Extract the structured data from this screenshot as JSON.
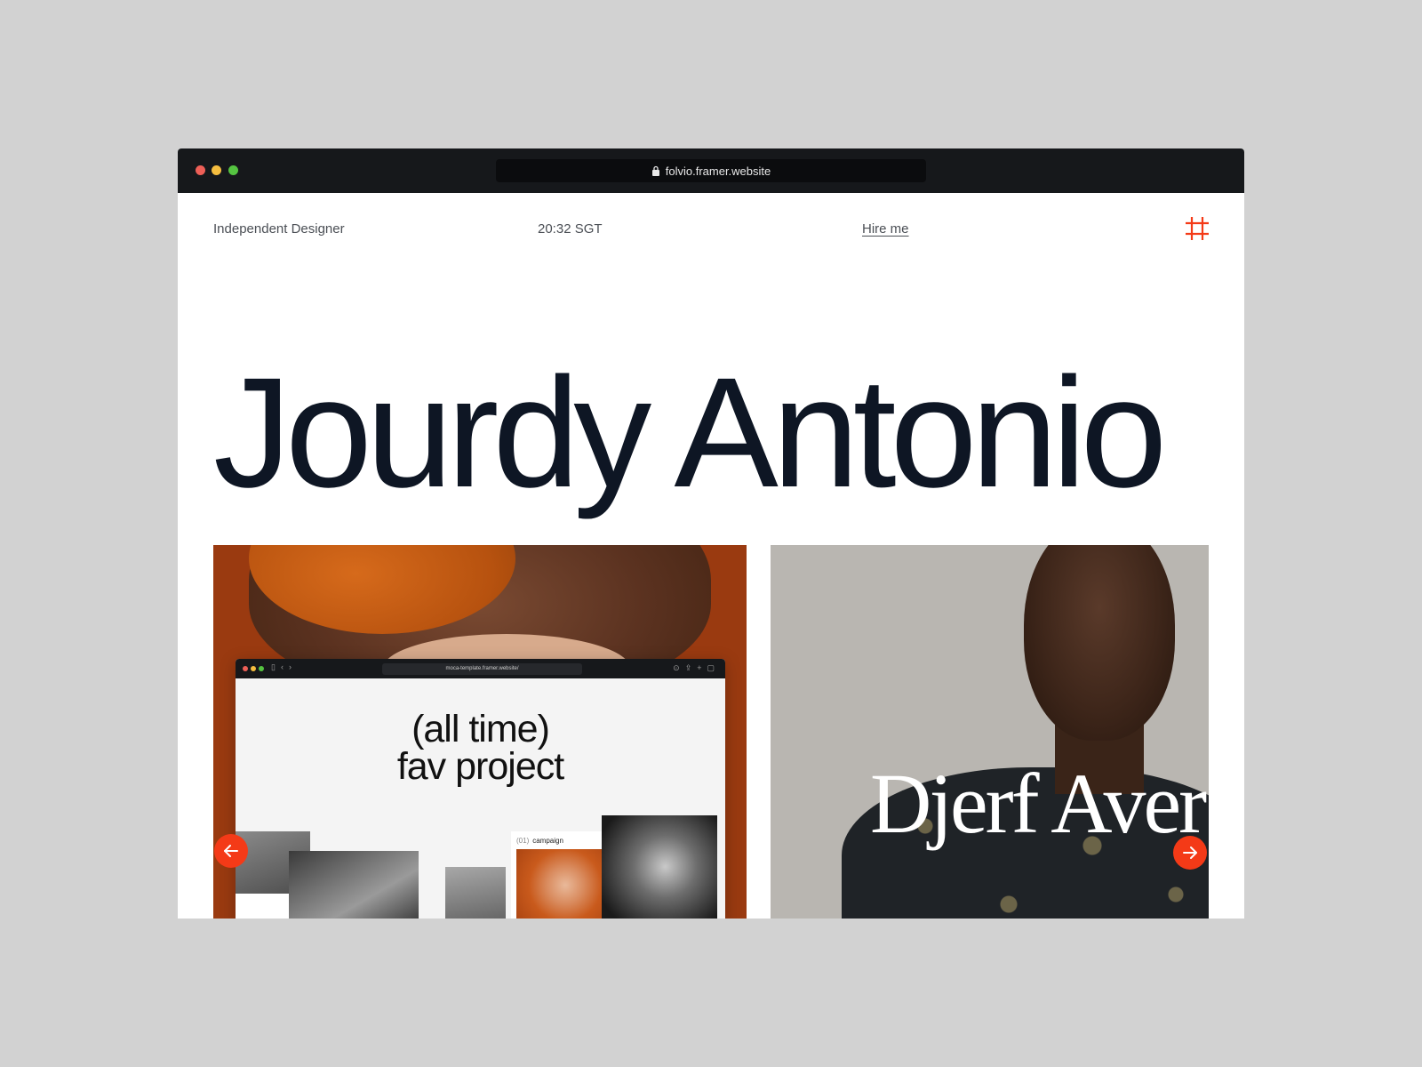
{
  "browser": {
    "url": "folvio.framer.website"
  },
  "nav": {
    "role": "Independent Designer",
    "time": "20:32 SGT",
    "hire_label": "Hire me",
    "menu_icon": "hash-icon"
  },
  "hero": {
    "name": "Jourdy Antonio"
  },
  "projects": [
    {
      "mockup_url": "moca-template.framer.website/",
      "mockup_title_line1": "(all time)",
      "mockup_title_line2": "fav project",
      "campaign_number": "(01)",
      "campaign_label": "campaign"
    },
    {
      "brand_text": "Djerf Aver"
    }
  ],
  "carousel": {
    "prev_icon": "arrow-left-icon",
    "next_icon": "arrow-right-icon"
  },
  "colors": {
    "accent": "#f43a17",
    "hero_text": "#0e1624",
    "chrome": "#16181b"
  }
}
